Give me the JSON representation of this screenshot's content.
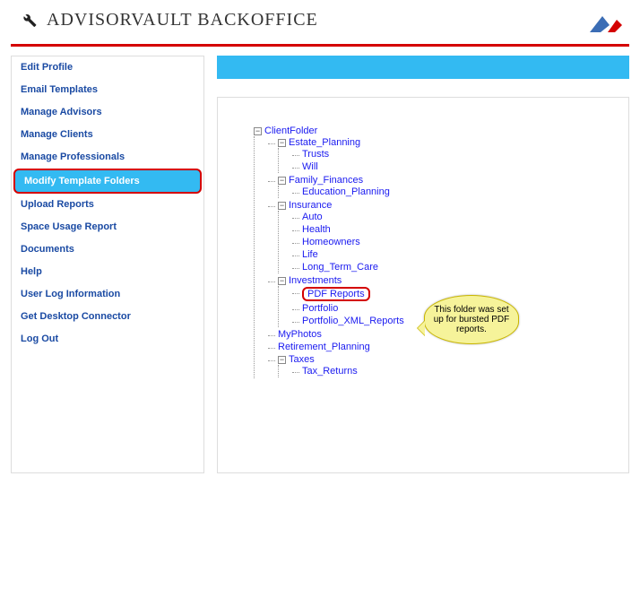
{
  "header": {
    "title": "ADVISORVAULT BACKOFFICE"
  },
  "sidebar": {
    "items": [
      {
        "label": "Edit Profile",
        "selected": false
      },
      {
        "label": "Email Templates",
        "selected": false
      },
      {
        "label": "Manage Advisors",
        "selected": false
      },
      {
        "label": "Manage Clients",
        "selected": false
      },
      {
        "label": "Manage Professionals",
        "selected": false
      },
      {
        "label": "Modify Template Folders",
        "selected": true
      },
      {
        "label": "Upload Reports",
        "selected": false
      },
      {
        "label": "Space Usage Report",
        "selected": false
      },
      {
        "label": "Documents",
        "selected": false
      },
      {
        "label": "Help",
        "selected": false
      },
      {
        "label": "User Log Information",
        "selected": false
      },
      {
        "label": "Get Desktop Connector",
        "selected": false
      },
      {
        "label": "Log Out",
        "selected": false
      }
    ]
  },
  "tree": {
    "root": "ClientFolder",
    "estate_planning": "Estate_Planning",
    "trusts": "Trusts",
    "will": "Will",
    "family_finances": "Family_Finances",
    "education_planning": "Education_Planning",
    "insurance": "Insurance",
    "auto": "Auto",
    "health": "Health",
    "homeowners": "Homeowners",
    "life": "Life",
    "long_term_care": "Long_Term_Care",
    "investments": "Investments",
    "pdf_reports": "PDF Reports",
    "portfolio": "Portfolio",
    "portfolio_xml": "Portfolio_XML_Reports",
    "myphotos": "MyPhotos",
    "retirement_planning": "Retirement_Planning",
    "taxes": "Taxes",
    "tax_returns": "Tax_Returns"
  },
  "callout": {
    "text": "This folder was set up for bursted PDF reports."
  },
  "icons": {
    "minus": "−",
    "plus": "+"
  }
}
